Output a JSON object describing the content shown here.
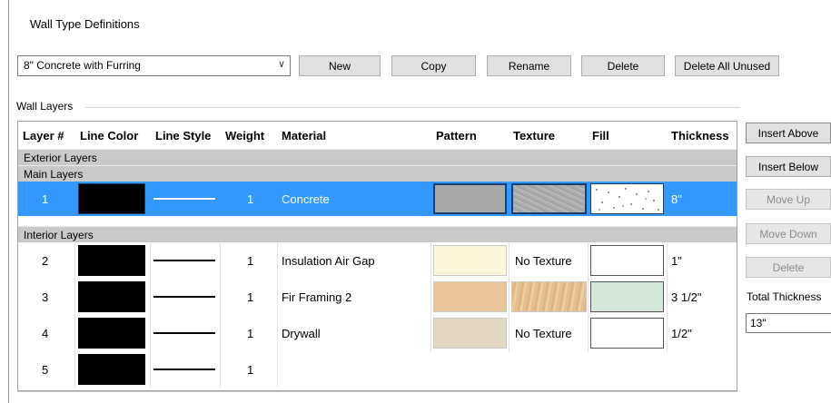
{
  "dialog": {
    "title": "Wall Type Definitions"
  },
  "wall_type": {
    "selected": "8\" Concrete with Furring"
  },
  "toolbar": {
    "new_label": "New",
    "copy_label": "Copy",
    "rename_label": "Rename",
    "delete_label": "Delete",
    "delete_unused_label": "Delete All Unused"
  },
  "wall_layers": {
    "group_label": "Wall Layers",
    "columns": [
      "Layer #",
      "Line Color",
      "Line Style",
      "Weight",
      "Material",
      "Pattern",
      "Texture",
      "Fill",
      "Thickness"
    ],
    "sections": {
      "exterior": "Exterior Layers",
      "main": "Main Layers",
      "interior": "Interior Layers"
    },
    "rows": [
      {
        "layer": "1",
        "line_color": "#000000",
        "weight": "1",
        "material": "Concrete",
        "pattern_color": "#a9a9a9",
        "texture": "concrete",
        "texture_label": "",
        "fill": "speckle",
        "thickness": "8\"",
        "selected": true
      },
      {
        "layer": "2",
        "line_color": "#000000",
        "weight": "1",
        "material": "Insulation Air Gap",
        "pattern_color": "#fdf7d9",
        "texture": "none",
        "texture_label": "No Texture",
        "fill": "#ffffff",
        "thickness": "1\"",
        "selected": false
      },
      {
        "layer": "3",
        "line_color": "#000000",
        "weight": "1",
        "material": "Fir Framing 2",
        "pattern_color": "#e9c59a",
        "texture": "wood",
        "texture_label": "",
        "fill": "#d2e8da",
        "thickness": "3 1/2\"",
        "selected": false
      },
      {
        "layer": "4",
        "line_color": "#000000",
        "weight": "1",
        "material": "Drywall",
        "pattern_color": "#e3d9c3",
        "texture": "none",
        "texture_label": "No Texture",
        "fill": "#ffffff",
        "thickness": "1/2\"",
        "selected": false
      },
      {
        "layer": "5",
        "line_color": "#000000",
        "weight": "1",
        "material": "",
        "pattern_color": "",
        "texture": "",
        "texture_label": "",
        "fill": "",
        "thickness": "",
        "selected": false
      }
    ]
  },
  "side_buttons": {
    "insert_above": "Insert Above",
    "insert_below": "Insert Below",
    "move_up": "Move Up",
    "move_down": "Move Down",
    "delete": "Delete"
  },
  "total_thickness": {
    "label": "Total Thickness",
    "value": "13\""
  },
  "colors": {
    "selection": "#3399ff",
    "section_bg": "#c9c9c9",
    "button_bg": "#e1e1e1"
  }
}
